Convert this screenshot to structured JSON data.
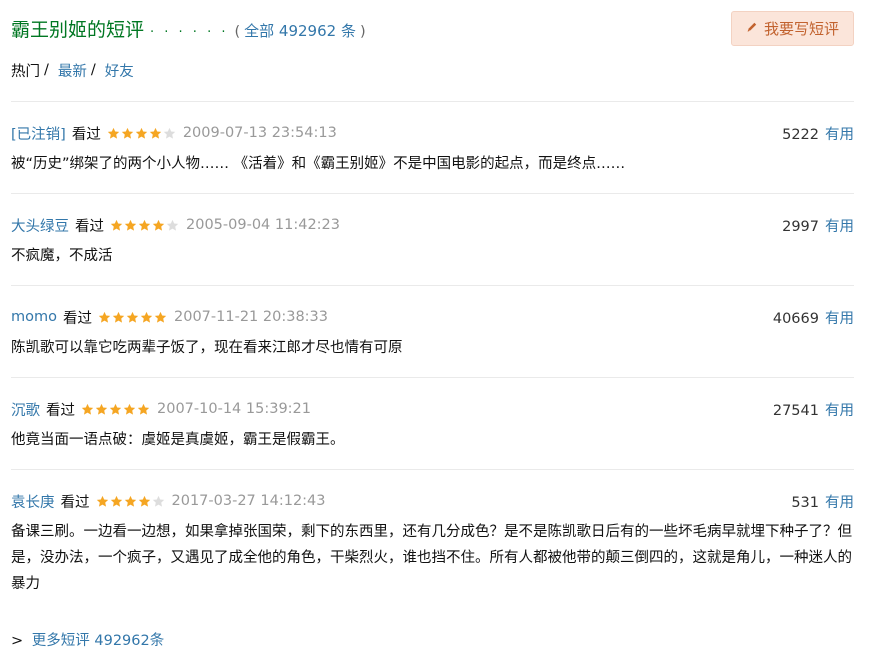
{
  "header": {
    "title": "霸王别姬的短评",
    "dots": "· · · · · ·",
    "count_open": "(",
    "count_text": "全部 492962 条",
    "count_close": ")",
    "write_button": "我要写短评"
  },
  "tabs": [
    {
      "label": "热门",
      "active": true
    },
    {
      "label": "最新",
      "active": false
    },
    {
      "label": "好友",
      "active": false
    }
  ],
  "tab_separator": "/",
  "colors": {
    "star_filled": "#f5a623",
    "star_empty": "#dddddd",
    "link": "#3377aa",
    "title": "#007722"
  },
  "comments": [
    {
      "user": "[已注销]",
      "status": "看过",
      "rating": 4,
      "time": "2009-07-13 23:54:13",
      "votes": "5222",
      "useful": "有用",
      "content": "被“历史”绑架了的两个小人物…… 《活着》和《霸王别姬》不是中国电影的起点，而是终点……"
    },
    {
      "user": "大头绿豆",
      "status": "看过",
      "rating": 4,
      "time": "2005-09-04 11:42:23",
      "votes": "2997",
      "useful": "有用",
      "content": "不疯魔，不成活"
    },
    {
      "user": "momo",
      "status": "看过",
      "rating": 5,
      "time": "2007-11-21 20:38:33",
      "votes": "40669",
      "useful": "有用",
      "content": "陈凯歌可以靠它吃两辈子饭了，现在看来江郎才尽也情有可原"
    },
    {
      "user": "沉歌",
      "status": "看过",
      "rating": 5,
      "time": "2007-10-14 15:39:21",
      "votes": "27541",
      "useful": "有用",
      "content": "他竟当面一语点破：虞姬是真虞姬，霸王是假霸王。"
    },
    {
      "user": "袁长庚",
      "status": "看过",
      "rating": 4,
      "time": "2017-03-27 14:12:43",
      "votes": "531",
      "useful": "有用",
      "content": "备课三刷。一边看一边想，如果拿掉张国荣，剩下的东西里，还有几分成色？是不是陈凯歌日后有的一些坏毛病早就埋下种子了？但是，没办法，一个疯子，又遇见了成全他的角色，干柴烈火，谁也挡不住。所有人都被他带的颠三倒四的，这就是角儿，一种迷人的暴力"
    }
  ],
  "footer": {
    "arrow": ">",
    "more_link": "更多短评 492962条"
  }
}
